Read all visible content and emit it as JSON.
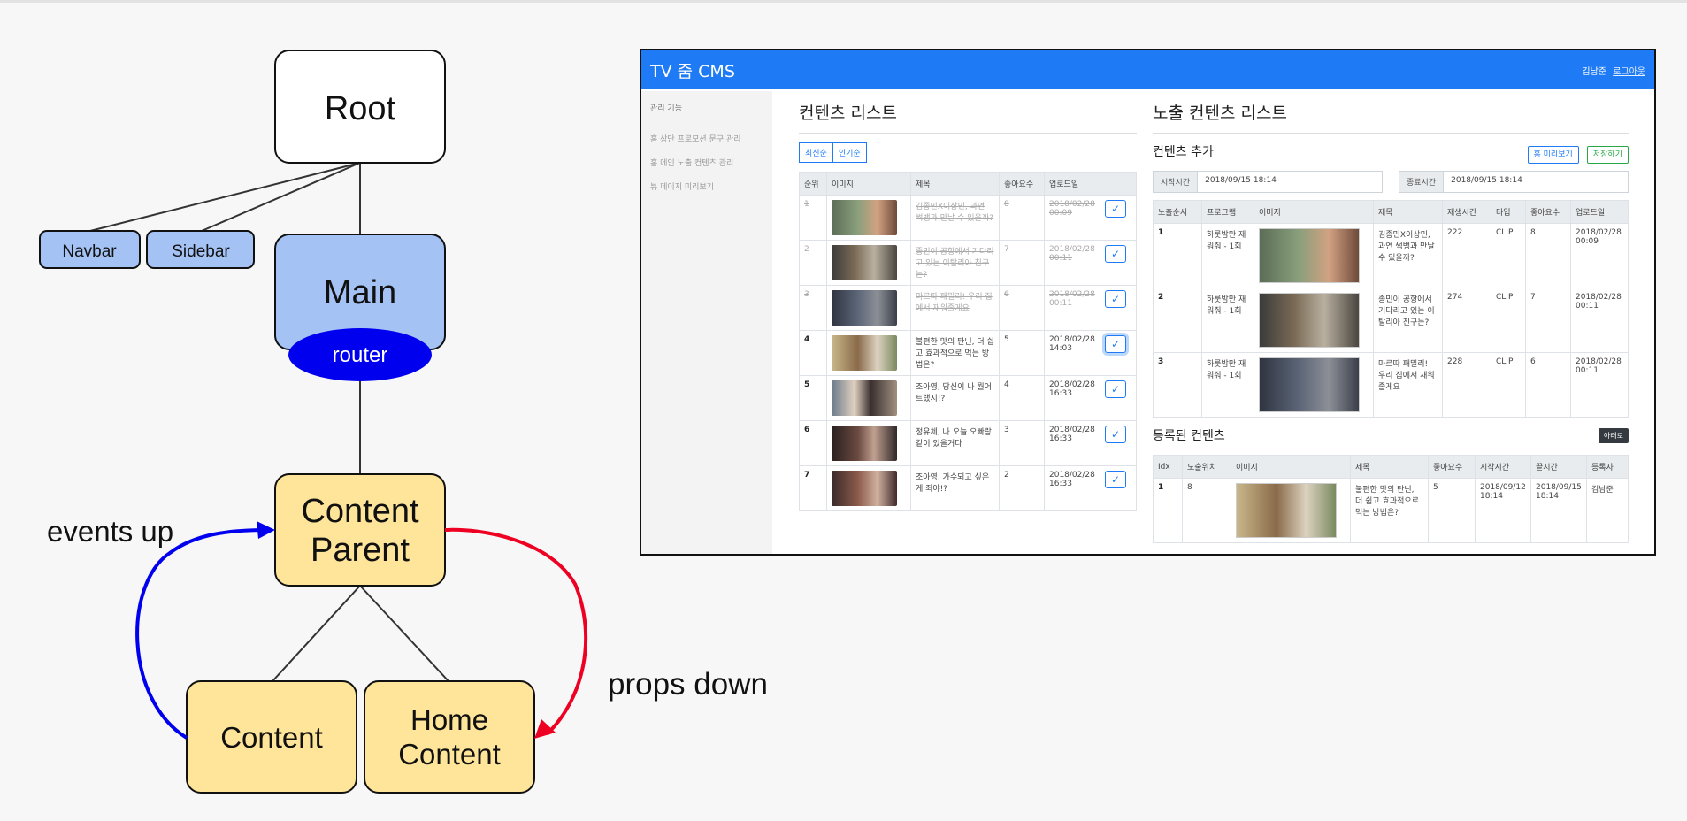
{
  "diagram": {
    "nodes": {
      "root": "Root",
      "navbar": "Navbar",
      "sidebar": "Sidebar",
      "main": "Main",
      "router": "router",
      "content_parent": [
        "Content",
        "Parent"
      ],
      "content": "Content",
      "home_content": [
        "Home",
        "Content"
      ]
    },
    "labels": {
      "events_up": "events up",
      "props_down": "props down"
    },
    "colors": {
      "white_node": "#ffffff",
      "blue_node": "#a4c2f4",
      "yellow_node": "#ffe599",
      "router": "#0000ee",
      "events_arrow": "#0000ee",
      "props_arrow": "#ee0022"
    }
  },
  "cms": {
    "brand": "TV 줌 CMS",
    "user": "김남준",
    "logout": "로그아웃",
    "sidebar": {
      "heading": "관리 기능",
      "items": [
        "홈 상단 프로모션 문구 관리",
        "홈 메인 노출 컨텐츠 관리",
        "뷰 페이지 미리보기"
      ]
    },
    "content_list": {
      "title": "컨텐츠 리스트",
      "sort_buttons": [
        "최신순",
        "인기순"
      ],
      "headers": [
        "순위",
        "이미지",
        "제목",
        "좋아요수",
        "업로드일"
      ],
      "rows": [
        {
          "rank": "1",
          "title": "김종민X이상민, 과연 썩뱅과 만날 수 있을까?",
          "likes": "8",
          "date": "2018/02/28 00:09",
          "strike": true
        },
        {
          "rank": "2",
          "title": "종민이 공항에서 기다리고 있는 이탈리아 친구는?",
          "likes": "7",
          "date": "2018/02/28 00:11",
          "strike": true
        },
        {
          "rank": "3",
          "title": "마르따 패밀리! 우리 집에서 재워줄게요",
          "likes": "6",
          "date": "2018/02/28 00:11",
          "strike": true
        },
        {
          "rank": "4",
          "title": "불편한 맛의 탄닌, 더 쉽고 효과적으로 먹는 방법은?",
          "likes": "5",
          "date": "2018/02/28 14:03",
          "strike": false
        },
        {
          "rank": "5",
          "title": "조아영, 당신이 나 뭘어트랬지!?",
          "likes": "4",
          "date": "2018/02/28 16:33",
          "strike": false
        },
        {
          "rank": "6",
          "title": "정유체, 나 오늘 오빠랑 같이 있을거다",
          "likes": "3",
          "date": "2018/02/28 16:33",
          "strike": false
        },
        {
          "rank": "7",
          "title": "조아영, 가수되고 싶은 게 죄야!?",
          "likes": "2",
          "date": "2018/02/28 16:33",
          "strike": false
        }
      ]
    },
    "exposed_list": {
      "title": "노출 컨텐츠 리스트",
      "add_title": "컨텐츠 추가",
      "buttons": [
        "홈 미리보기",
        "저장하기"
      ],
      "start_label": "시작시간",
      "start_value": "2018/09/15 18:14",
      "end_label": "종료시간",
      "end_value": "2018/09/15 18:14",
      "headers": [
        "노출순서",
        "프로그램",
        "이미지",
        "제목",
        "재생시간",
        "타입",
        "좋아요수",
        "업로드일"
      ],
      "rows": [
        {
          "order": "1",
          "program": "하룻밤만 재워줘 - 1회",
          "title": "김종민X이상민, 과연 썩뱅과 만날 수 있을까?",
          "duration": "222",
          "type": "CLIP",
          "likes": "8",
          "date": "2018/02/28 00:09"
        },
        {
          "order": "2",
          "program": "하룻밤만 재워줘 - 1회",
          "title": "종민이 공항에서 기다리고 있는 이탈리아 친구는?",
          "duration": "274",
          "type": "CLIP",
          "likes": "7",
          "date": "2018/02/28 00:11"
        },
        {
          "order": "3",
          "program": "하룻밤만 재워줘 - 1회",
          "title": "마르따 패밀리! 우리 집에서 재워줄게요",
          "duration": "228",
          "type": "CLIP",
          "likes": "6",
          "date": "2018/02/28 00:11"
        }
      ]
    },
    "registered": {
      "title": "등록된 컨텐츠",
      "button": "아래로",
      "headers": [
        "Idx",
        "노출위치",
        "이미지",
        "제목",
        "좋아요수",
        "시작시간",
        "끝시간",
        "등록자"
      ],
      "rows": [
        {
          "idx": "1",
          "position": "8",
          "title": "불편한 맛의 탄닌, 더 쉽고 효과적으로 먹는 방법은?",
          "likes": "5",
          "start": "2018/09/12 18:14",
          "end": "2018/09/15 18:14",
          "author": "김남준"
        }
      ]
    }
  }
}
